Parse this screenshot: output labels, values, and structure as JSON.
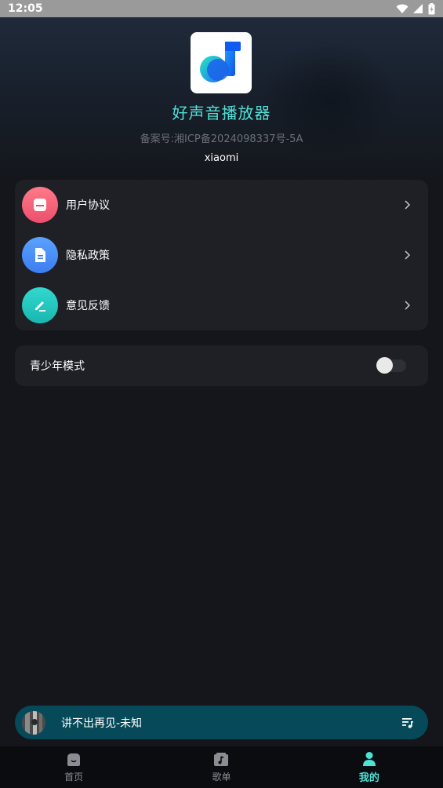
{
  "status_bar": {
    "time": "12:05",
    "icons": [
      "wifi-icon",
      "signal-icon",
      "battery-icon"
    ]
  },
  "app": {
    "name": "好声音播放器",
    "license": "备案号:湘ICP备2024098337号-5A",
    "vendor": "xiaomi",
    "logo_icon": "music-note-logo"
  },
  "menu": {
    "items": [
      {
        "label": "用户协议",
        "icon": "agreement-icon",
        "color": "#f3607a"
      },
      {
        "label": "隐私政策",
        "icon": "document-icon",
        "color": "#4a8cf2"
      },
      {
        "label": "意见反馈",
        "icon": "edit-pencil-icon",
        "color": "#22c7c0"
      }
    ]
  },
  "teen_mode": {
    "label": "青少年模式",
    "enabled": false
  },
  "player": {
    "now_playing": "讲不出再见-未知",
    "playlist_icon": "playlist-icon"
  },
  "bottom_nav": {
    "items": [
      {
        "label": "首页",
        "icon": "home-icon",
        "active": false
      },
      {
        "label": "歌单",
        "icon": "music-album-icon",
        "active": false
      },
      {
        "label": "我的",
        "icon": "profile-icon",
        "active": true
      }
    ]
  },
  "colors": {
    "accent": "#4fe0d6",
    "background": "#14161b",
    "card": "#1e2026",
    "player": "#064a59"
  }
}
